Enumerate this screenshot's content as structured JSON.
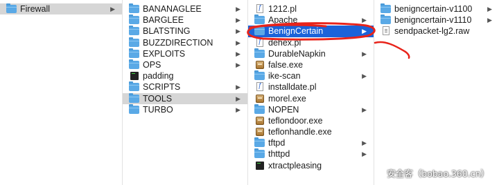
{
  "columns": [
    {
      "name": "column-1",
      "items": [
        {
          "label": "Firewall",
          "icon": "folder",
          "has_children": true,
          "selected": "gray"
        }
      ]
    },
    {
      "name": "column-2",
      "items": [
        {
          "label": "BANANAGLEE",
          "icon": "folder",
          "has_children": true
        },
        {
          "label": "BARGLEE",
          "icon": "folder",
          "has_children": true
        },
        {
          "label": "BLATSTING",
          "icon": "folder",
          "has_children": true
        },
        {
          "label": "BUZZDIRECTION",
          "icon": "folder",
          "has_children": true
        },
        {
          "label": "EXPLOITS",
          "icon": "folder",
          "has_children": true
        },
        {
          "label": "OPS",
          "icon": "folder",
          "has_children": true
        },
        {
          "label": "padding",
          "icon": "unix-executable",
          "has_children": false
        },
        {
          "label": "SCRIPTS",
          "icon": "folder",
          "has_children": true
        },
        {
          "label": "TOOLS",
          "icon": "folder",
          "has_children": true,
          "selected": "gray"
        },
        {
          "label": "TURBO",
          "icon": "folder",
          "has_children": true
        }
      ]
    },
    {
      "name": "column-3",
      "items": [
        {
          "label": "1212.pl",
          "icon": "script",
          "has_children": false
        },
        {
          "label": "Apache",
          "icon": "folder",
          "has_children": true
        },
        {
          "label": "BenignCertain",
          "icon": "folder",
          "has_children": true,
          "selected": "blue"
        },
        {
          "label": "dehex.pl",
          "icon": "script",
          "has_children": false
        },
        {
          "label": "DurableNapkin",
          "icon": "folder",
          "has_children": true
        },
        {
          "label": "false.exe",
          "icon": "exe",
          "has_children": false
        },
        {
          "label": "ike-scan",
          "icon": "folder",
          "has_children": true
        },
        {
          "label": "installdate.pl",
          "icon": "script",
          "has_children": false
        },
        {
          "label": "morel.exe",
          "icon": "exe",
          "has_children": false
        },
        {
          "label": "NOPEN",
          "icon": "folder",
          "has_children": true
        },
        {
          "label": "teflondoor.exe",
          "icon": "exe",
          "has_children": false
        },
        {
          "label": "teflonhandle.exe",
          "icon": "exe",
          "has_children": false
        },
        {
          "label": "tftpd",
          "icon": "folder",
          "has_children": true
        },
        {
          "label": "thttpd",
          "icon": "folder",
          "has_children": true
        },
        {
          "label": "xtractpleasing",
          "icon": "unix-executable",
          "has_children": false
        }
      ]
    },
    {
      "name": "column-4",
      "items": [
        {
          "label": "benigncertain-v1100",
          "icon": "folder",
          "has_children": true
        },
        {
          "label": "benigncertain-v1110",
          "icon": "folder",
          "has_children": true
        },
        {
          "label": "sendpacket-lg2.raw",
          "icon": "raw-file",
          "has_children": false
        }
      ]
    }
  ],
  "chevron": "▶",
  "watermark": "安全客（bobao.360.cn）",
  "colors": {
    "selection_blue": "#1b63d9",
    "selection_gray": "#d6d6d6",
    "annotation_red": "#e8231a",
    "folder": "#5aa9e6"
  }
}
